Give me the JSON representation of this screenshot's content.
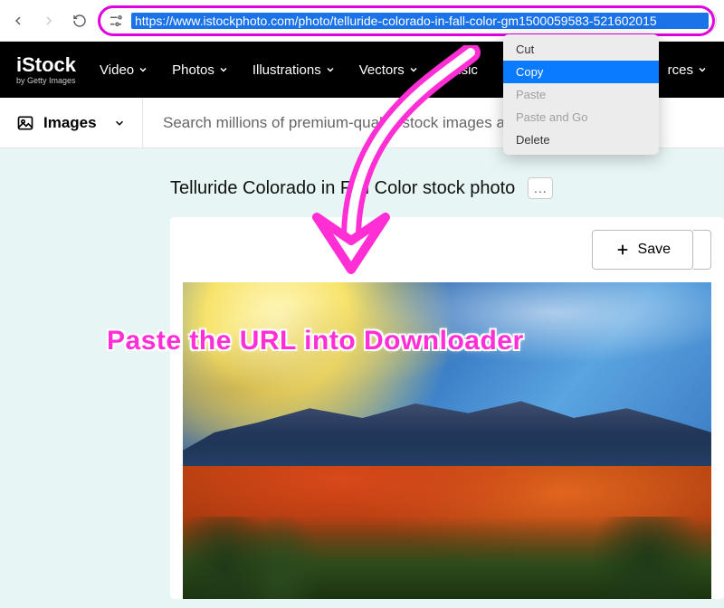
{
  "browser": {
    "url": "https://www.istockphoto.com/photo/telluride-colorado-in-fall-color-gm1500059583-521602015"
  },
  "context_menu": {
    "items": [
      {
        "label": "Cut",
        "state": "normal"
      },
      {
        "label": "Copy",
        "state": "selected"
      },
      {
        "label": "Paste",
        "state": "disabled"
      },
      {
        "label": "Paste and Go",
        "state": "disabled"
      },
      {
        "label": "Delete",
        "state": "normal"
      }
    ]
  },
  "header": {
    "logo_main": "iStock",
    "logo_sub": "by Getty Images",
    "nav": [
      "Video",
      "Photos",
      "Illustrations",
      "Vectors",
      "Music"
    ],
    "nav_right": "rces"
  },
  "search": {
    "type_label": "Images",
    "placeholder": "Search millions of premium-quality stock images and videos"
  },
  "page": {
    "title": "Telluride Colorado in Fall Color stock photo",
    "more": "...",
    "save_label": "Save"
  },
  "annotation": {
    "text": "Paste the URL into Downloader"
  }
}
